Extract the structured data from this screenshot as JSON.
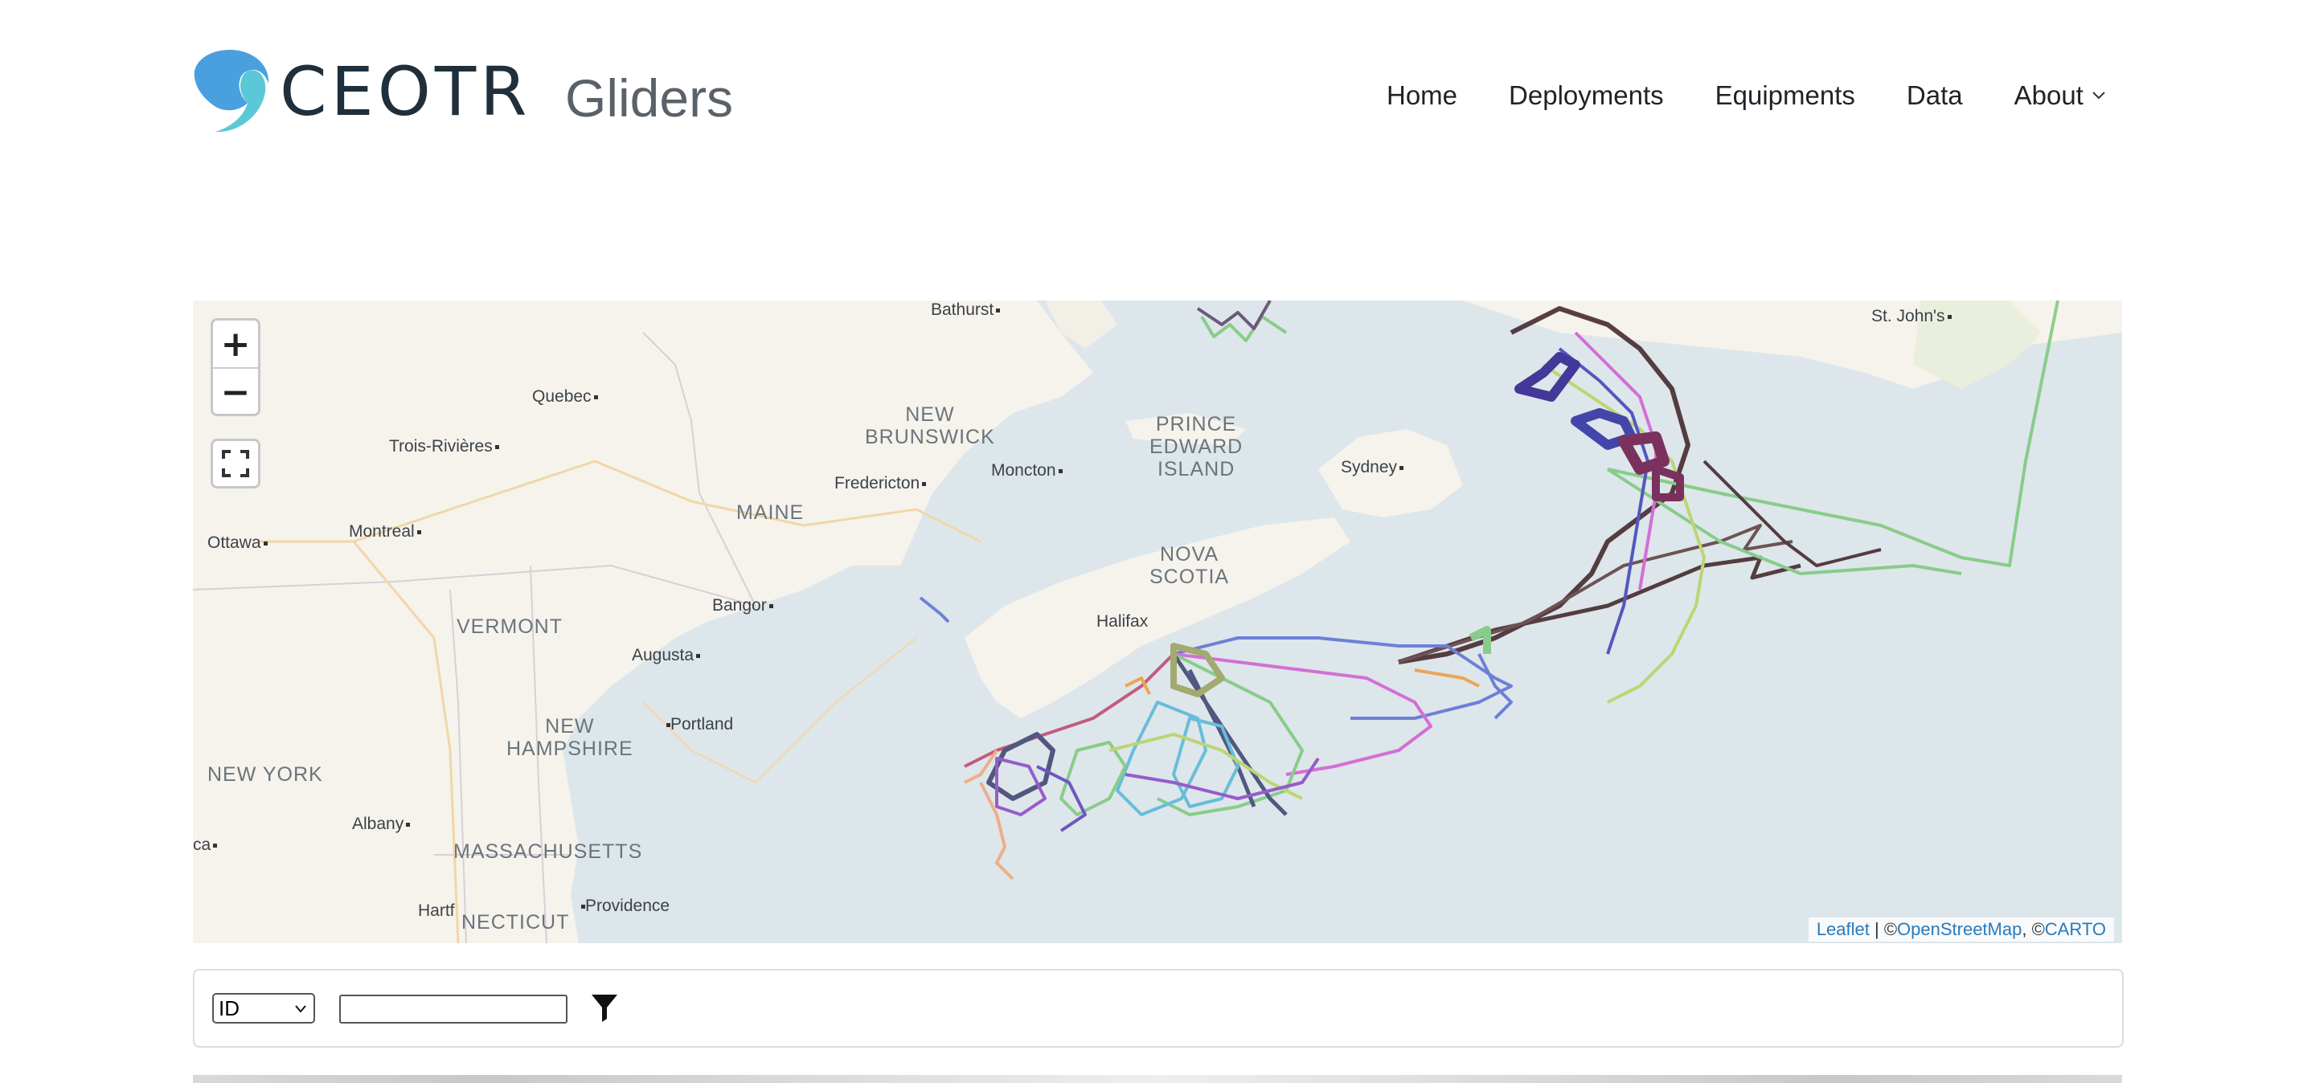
{
  "header": {
    "logo_text": "CEOTR",
    "site_title": "Gliders",
    "nav": [
      {
        "label": "Home"
      },
      {
        "label": "Deployments"
      },
      {
        "label": "Equipments"
      },
      {
        "label": "Data"
      },
      {
        "label": "About"
      }
    ],
    "brand_colors": {
      "logo_blue": "#4aa0de",
      "logo_teal": "#5bc8d8",
      "text_dark": "#1f2f3b"
    }
  },
  "map": {
    "controls": {
      "zoom_in": "+",
      "zoom_out": "−"
    },
    "labels": {
      "bathurst": "Bathurst",
      "st_johns": "St. John's",
      "quebec": "Quebec",
      "trois_rivieres": "Trois-Rivières",
      "new_brunswick": "NEW\nBRUNSWICK",
      "prince_edward_island": "PRINCE\nEDWARD\nISLAND",
      "fredericton": "Fredericton",
      "moncton": "Moncton",
      "sydney": "Sydney",
      "maine": "MAINE",
      "montreal": "Montreal",
      "ottawa": "Ottawa",
      "nova_scotia": "NOVA\nSCOTIA",
      "bangor": "Bangor",
      "halifax": "Halifax",
      "vermont": "VERMONT",
      "augusta": "Augusta",
      "new_hampshire": "NEW\nHAMPSHIRE",
      "portland": "Portland",
      "new_york": "NEW YORK",
      "albany": "Albany",
      "massachusetts": "MASSACHUSETTS",
      "ca": "ca",
      "hartf": "Hartf",
      "necticut": "NECTICUT",
      "providence": "Providence"
    },
    "attribution": {
      "leaflet": "Leaflet",
      "separator": " | ©",
      "osm": "OpenStreetMap",
      "comma": ", ©",
      "carto": "CARTO"
    },
    "colors": {
      "water": "#dde6ea",
      "land": "#f6f3ec",
      "track_dark": "#3d1f24",
      "track_green": "#7ac87a"
    }
  },
  "filter": {
    "field_select_value": "ID",
    "search_value": ""
  }
}
